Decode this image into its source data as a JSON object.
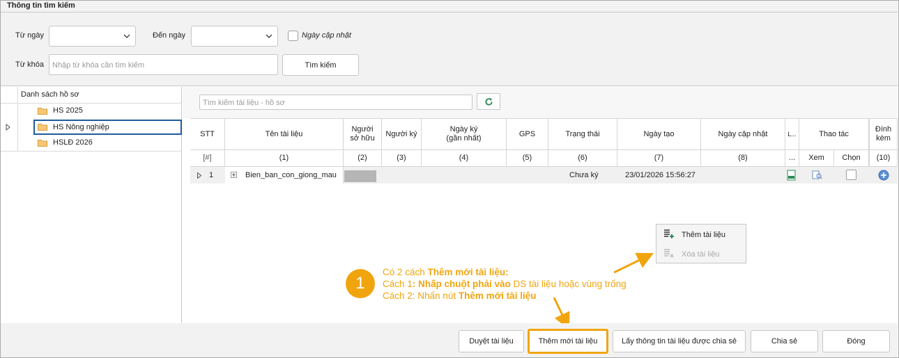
{
  "search_panel": {
    "title": "Thông tin tìm kiếm",
    "from_date_label": "Từ ngày",
    "to_date_label": "Đến ngày",
    "updated_date_label": "Ngày cập nhật",
    "keyword_label": "Từ khóa",
    "keyword_placeholder": "Nhập từ khóa cần tìm kiếm",
    "search_button": "Tìm kiếm"
  },
  "tree": {
    "header": "Danh sách hồ sơ",
    "items": [
      {
        "label": "HS 2025"
      },
      {
        "label": "HS Nông nghiệp",
        "selected": true
      },
      {
        "label": "HSLĐ 2026"
      }
    ]
  },
  "grid": {
    "search_placeholder": "Tìm kiếm tài liệu - hồ sơ",
    "columns": [
      {
        "header": "STT",
        "index": "[#]"
      },
      {
        "header": "Tên tài liệu",
        "index": "(1)"
      },
      {
        "header": "Người sở hữu",
        "index": "(2)"
      },
      {
        "header": "Người ký",
        "index": "(3)"
      },
      {
        "header": "Ngày ký (gần nhất)",
        "index": "(4)"
      },
      {
        "header": "GPS",
        "index": "(5)"
      },
      {
        "header": "Trạng thái",
        "index": "(6)"
      },
      {
        "header": "Ngày tạo",
        "index": "(7)"
      },
      {
        "header": "Ngày cập nhật",
        "index": "(8)"
      },
      {
        "header": "L...",
        "index": "..."
      },
      {
        "header": "Thao tác",
        "sub": [
          "Xem",
          "Chọn"
        ]
      },
      {
        "header": "Đính kèm",
        "index": "(10)"
      }
    ],
    "rows": [
      {
        "stt": "1",
        "name": "Bien_ban_con_giong_mau",
        "status": "Chưa ký",
        "created": "23/01/2026 15:56:27"
      }
    ]
  },
  "context_menu": {
    "add": "Thêm tài liệu",
    "delete": "Xóa tài liệu"
  },
  "annotation": {
    "badge": "1",
    "line1_pre": "Có 2 cách ",
    "line1_bold": "Thêm mới tài liệu:",
    "line2_pre": "Cách 1",
    "line2_bold": ": Nhấp chuột phải vào",
    "line2_post": " DS tài liệu hoặc vùng trống",
    "line3_pre": "Cách 2",
    "line3_mid": ": Nhấn nút ",
    "line3_bold": "Thêm mới tài liệu"
  },
  "bottom_bar": {
    "approve": "Duyệt tài liệu",
    "add_new": "Thêm mới tài liệu",
    "get_shared": "Lấy thông tin tài liệu được chia sẻ",
    "share": "Chia sẻ",
    "close": "Đóng"
  },
  "colors": {
    "accent_orange": "#f0a50f",
    "selection_blue": "#1f5b9e",
    "refresh_green": "#2e8b57"
  }
}
